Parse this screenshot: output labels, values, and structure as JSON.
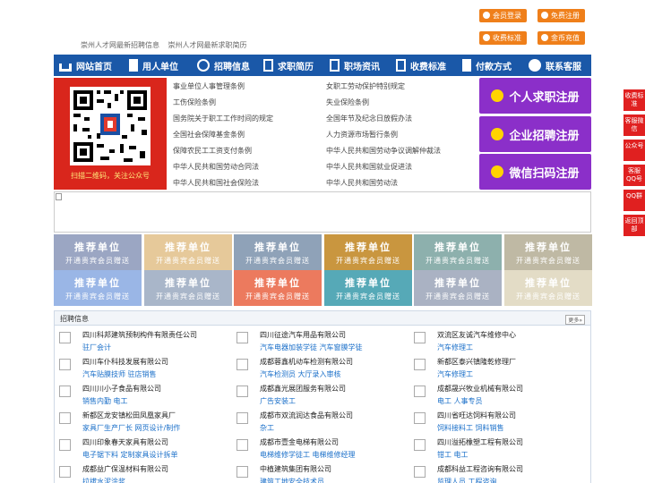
{
  "header": {
    "links": [
      "崇州人才网最新招聘信息",
      "崇州人才网最新求职简历"
    ],
    "buttons": [
      "会员登录",
      "免费注册",
      "收费标准",
      "金币充值"
    ]
  },
  "nav": {
    "items": [
      "网站首页",
      "用人单位",
      "招聘信息",
      "求职简历",
      "职场资讯",
      "收费标准",
      "付款方式",
      "联系客服"
    ]
  },
  "qr": {
    "caption": "扫描二维码，关注公众号"
  },
  "policies": [
    "事业单位人事管理条例",
    "女职工劳动保护特别规定",
    "工伤保险条例",
    "失业保险条例",
    "国务院关于职工工作时间的规定",
    "全国年节及纪念日放假办法",
    "全国社会保障基金条例",
    "人力资源市场暂行条例",
    "保障农民工工资支付条例",
    "中华人民共和国劳动争议调解仲裁法",
    "中华人民共和国劳动合同法",
    "中华人民共和国就业促进法",
    "中华人民共和国社会保险法",
    "中华人民共和国劳动法"
  ],
  "register": [
    "个人求职注册",
    "企业招聘注册",
    "微信扫码注册"
  ],
  "recommend": {
    "title": "推荐单位",
    "subtitle": "开通贵宾会员赠送",
    "colors": [
      "#9ba6c3",
      "#e6c99a",
      "#8fa2b8",
      "#c9963f",
      "#8db0ad",
      "#bfb9a4",
      "#9ab6e6",
      "#a9b6c9",
      "#ec7a5e",
      "#56a9b7",
      "#aab2c3",
      "#e3dcc6"
    ]
  },
  "jobs": {
    "title": "招聘信息",
    "more": "更多»",
    "items": [
      {
        "company": "四川科邦建筑预制构件有限责任公司",
        "positions": "驻厂会计"
      },
      {
        "company": "四川征途汽车用品有限公司",
        "positions": "汽车电器加装学徒 汽车窗膜学徒"
      },
      {
        "company": "双流区友诚汽车维修中心",
        "positions": "汽车修理工"
      },
      {
        "company": "四川车仆科技发展有限公司",
        "positions": "汽车贴膜技师 驻店销售"
      },
      {
        "company": "成都蓉鑫机动车检测有限公司",
        "positions": "汽车检测员 大厅录入审核"
      },
      {
        "company": "新都区泰兴镇隆乾修理厂",
        "positions": "汽车修理工"
      },
      {
        "company": "四川川小子食品有限公司",
        "positions": "销售内勤 电工"
      },
      {
        "company": "成都鑫光展团服务有限公司",
        "positions": "广告安装工"
      },
      {
        "company": "成都晟兴牧业机械有限公司",
        "positions": "电工 人事专员"
      },
      {
        "company": "新都区龙安镇松田凤凰家具厂",
        "positions": "家具厂生产厂长 网页设计/制作"
      },
      {
        "company": "成都市双流润达食品有限公司",
        "positions": "杂工"
      },
      {
        "company": "四川省旺达饲料有限公司",
        "positions": "饲料接料工 饲料销售"
      },
      {
        "company": "四川印象春天家具有限公司",
        "positions": "电子锯下料 定制家具设计拆单"
      },
      {
        "company": "成都市壹金电梯有限公司",
        "positions": "电梯维修学徒工 电梯维修经理"
      },
      {
        "company": "四川溢拓橡塑工程有限公司",
        "positions": "钳工 电工"
      },
      {
        "company": "成都益广保温材料有限公司",
        "positions": "拉拔水泥涂浆"
      },
      {
        "company": "中植建筑集团有限公司",
        "positions": "建筑工地安全技术员"
      },
      {
        "company": "成都科益工程咨询有限公司",
        "positions": "监理人员 工程咨询"
      }
    ]
  },
  "side": [
    "收费标准",
    "客服微信",
    "公众号",
    "客服QQ号",
    "QQ群",
    "返回顶部"
  ]
}
